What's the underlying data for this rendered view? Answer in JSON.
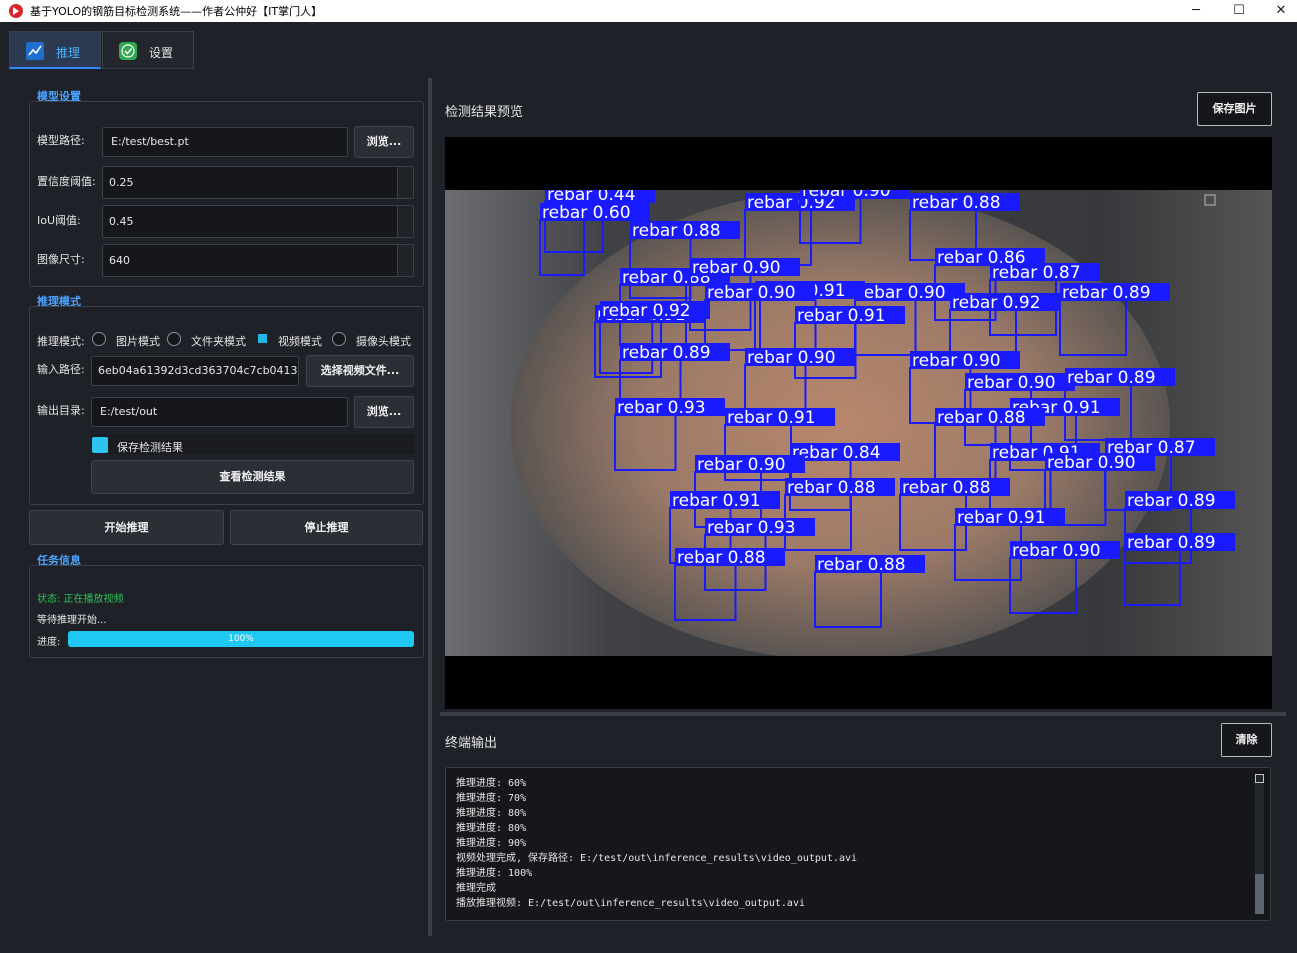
{
  "window": {
    "title": "基于YOLO的钢筋目标检测系统——作者公仲好【IT掌门人】",
    "minimize_icon": "─",
    "maximize_icon": "☐",
    "close_icon": "✕"
  },
  "tabs": [
    {
      "label": "推理",
      "icon": "chart-line-icon"
    },
    {
      "label": "设置",
      "icon": "check-shield-icon"
    }
  ],
  "model_settings": {
    "section_title": "模型设置",
    "model_path_label": "模型路径:",
    "model_path_value": "E:/test/best.pt",
    "browse_label": "浏览...",
    "confidence_label": "置信度阈值:",
    "confidence_value": "0.25",
    "iou_label": "IoU阈值:",
    "iou_value": "0.45",
    "image_size_label": "图像尺寸:",
    "image_size_value": "640"
  },
  "inference_mode": {
    "section_title": "推理模式",
    "mode_label": "推理模式:",
    "modes": [
      "图片模式",
      "文件夹模式",
      "视频模式",
      "摄像头模式"
    ],
    "selected_mode": "视频模式",
    "input_path_label": "输入路径:",
    "input_path_value": "6eb04a61392d3cd363704c7cb0413.mp4",
    "select_video_label": "选择视频文件...",
    "output_dir_label": "输出目录:",
    "output_dir_value": "E:/test/out",
    "browse_label": "浏览...",
    "save_results_label": "保存检测结果",
    "save_results_checked": true,
    "view_results_label": "查看检测结果"
  },
  "actions": {
    "start_label": "开始推理",
    "stop_label": "停止推理"
  },
  "task_info": {
    "section_title": "任务信息",
    "status": "状态: 正在播放视频",
    "waiting": "等待推理开始...",
    "progress_label": "进度:",
    "progress_value": 100,
    "progress_text": "100%"
  },
  "preview": {
    "title": "检测结果预览",
    "save_label": "保存图片"
  },
  "detections": {
    "label_class": "rebar",
    "items": [
      [
        "rebar 0.44"
      ],
      [
        "rebar 0.60"
      ],
      [
        "rebar 0.88"
      ],
      [
        "rebar 0.92"
      ],
      [
        "rebar 0.90"
      ],
      [
        "rebar 0.88"
      ],
      [
        "rebar 0.88"
      ],
      [
        "rebar 0.90"
      ],
      [
        "rebar 0.86"
      ],
      [
        "rebar 0.87"
      ],
      [
        "rebar 0.90"
      ],
      [
        "rebar 0.91"
      ],
      [
        "rebar 0.90"
      ],
      [
        "rebar 0.89"
      ],
      [
        "rebar 0.92"
      ],
      [
        "rebar 0.91"
      ],
      [
        "rebar 0.92"
      ],
      [
        "rebar 0.91"
      ],
      [
        "rebar 0.89"
      ],
      [
        "rebar 0.90"
      ],
      [
        "rebar 0.90"
      ],
      [
        "rebar 0.93"
      ],
      [
        "rebar 0.90"
      ],
      [
        "rebar 0.89"
      ],
      [
        "rebar 0.91"
      ],
      [
        "rebar 0.88"
      ],
      [
        "rebar 0.91"
      ],
      [
        "rebar 0.84"
      ],
      [
        "rebar 0.90"
      ],
      [
        "rebar 0.91"
      ],
      [
        "rebar 0.87"
      ],
      [
        "rebar 0.90"
      ],
      [
        "rebar 0.91"
      ],
      [
        "rebar 0.88"
      ],
      [
        "rebar 0.88"
      ],
      [
        "rebar 0.89"
      ],
      [
        "rebar 0.91"
      ],
      [
        "rebar 0.93"
      ],
      [
        "rebar 0.88"
      ],
      [
        "rebar 0.88"
      ],
      [
        "rebar 0.90"
      ],
      [
        "rebar 0.89"
      ]
    ]
  },
  "terminal": {
    "title": "终端输出",
    "clear_label": "清除",
    "lines": [
      "推理进度: 60%",
      "推理进度: 70%",
      "推理进度: 80%",
      "推理进度: 80%",
      "推理进度: 90%",
      "视频处理完成, 保存路径: E:/test/out\\inference_results\\video_output.avi",
      "推理进度: 100%",
      "推理完成",
      "播放推理视频: E:/test/out\\inference_results\\video_output.avi"
    ]
  },
  "colors": {
    "accent": "#2f88ff",
    "progress": "#1ec8f2",
    "status_green": "#31c05a",
    "box_blue": "#1a1aff"
  }
}
